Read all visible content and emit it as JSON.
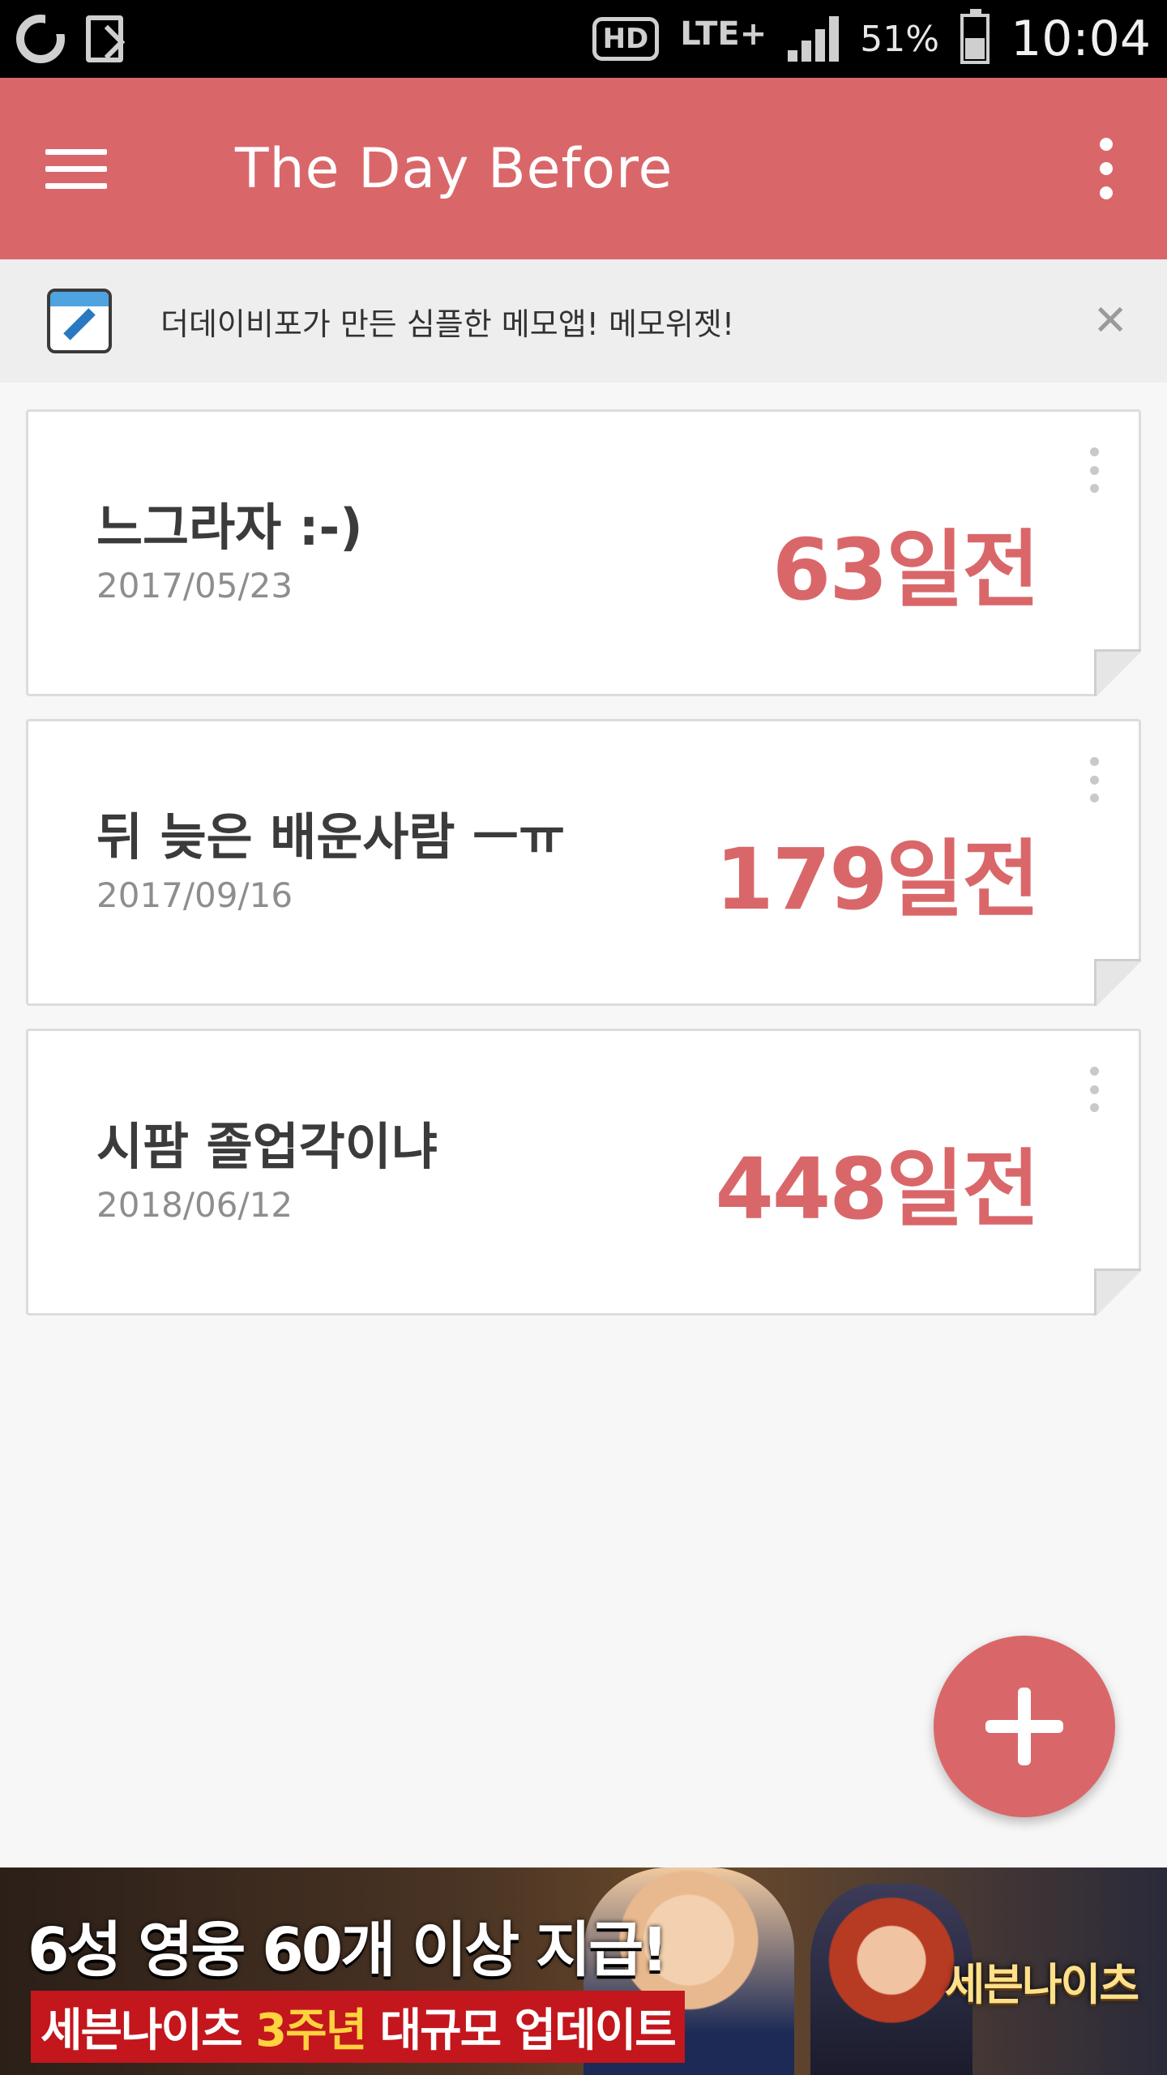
{
  "status_bar": {
    "battery": "51%",
    "battery_level": 0.51,
    "time": "10:04",
    "network": "LTE+",
    "hd_badge": "HD",
    "icons": [
      "o-app-icon",
      "document-icon",
      "hd-voice-icon",
      "lte-icon",
      "signal-icon",
      "battery-icon"
    ]
  },
  "app_bar": {
    "title": "The Day Before",
    "background": "#d9676a"
  },
  "promo": {
    "text": "더데이비포가 만든 심플한 메모앱! 메모위젯!",
    "close": "✕"
  },
  "cards": [
    {
      "title": "느그라자 :-)",
      "date": "2017/05/23",
      "count": "63일전"
    },
    {
      "title": "뒤 늦은 배운사람 ㅡㅠ",
      "date": "2017/09/16",
      "count": "179일전"
    },
    {
      "title": "시팜 졸업각이냐",
      "date": "2018/06/12",
      "count": "448일전"
    }
  ],
  "fab": {
    "icon": "plus-icon",
    "color": "#d9676a"
  },
  "ad": {
    "headline": "6성 영웅 60개 이상 지급!",
    "sub_prefix": "세븐나이츠 ",
    "sub_highlight": "3주년",
    "sub_suffix": " 대규모 업데이트",
    "logo": "세븐나이츠"
  }
}
